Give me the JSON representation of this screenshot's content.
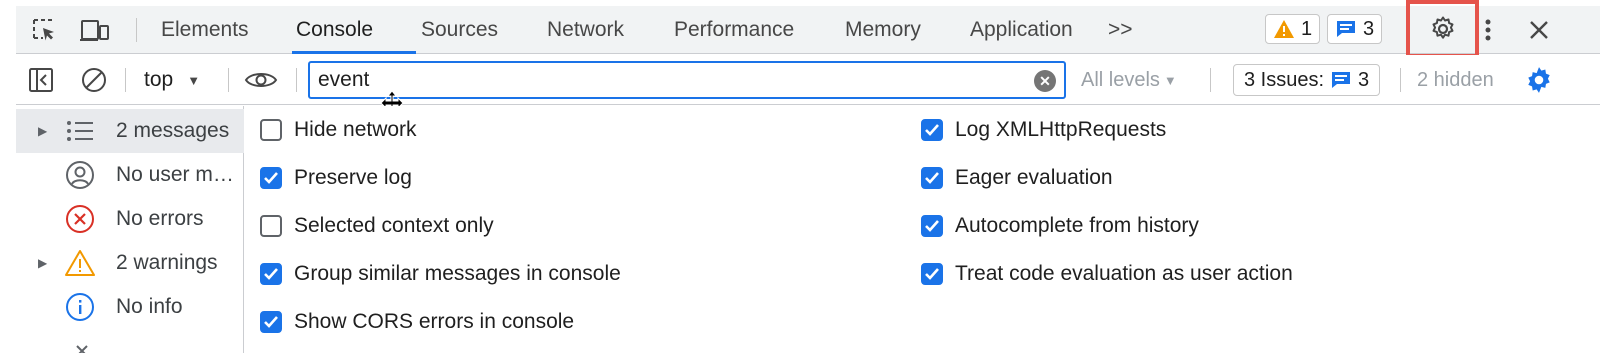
{
  "tabbar": {
    "tabs": [
      {
        "label": "Elements"
      },
      {
        "label": "Console"
      },
      {
        "label": "Sources"
      },
      {
        "label": "Network"
      },
      {
        "label": "Performance"
      },
      {
        "label": "Memory"
      },
      {
        "label": "Application"
      }
    ],
    "active_tab": "Console",
    "more_tabs": ">>",
    "warnings_count": "1",
    "messages_count": "3"
  },
  "toolbar": {
    "context": "top",
    "filter_value": "event",
    "levels": "All levels",
    "issues_label": "3 Issues:",
    "issues_count": "3",
    "hidden": "2 hidden"
  },
  "sidebar": {
    "items": [
      {
        "label": "2 messages",
        "icon": "list-icon",
        "expandable": true
      },
      {
        "label": "No user messages",
        "icon": "user-icon",
        "expandable": false
      },
      {
        "label": "No errors",
        "icon": "error-icon",
        "expandable": false
      },
      {
        "label": "2 warnings",
        "icon": "warning-icon",
        "expandable": true
      },
      {
        "label": "No info",
        "icon": "info-icon",
        "expandable": false
      }
    ]
  },
  "settings": {
    "left": [
      {
        "label": "Hide network",
        "checked": false
      },
      {
        "label": "Preserve log",
        "checked": true
      },
      {
        "label": "Selected context only",
        "checked": false
      },
      {
        "label": "Group similar messages in console",
        "checked": true
      },
      {
        "label": "Show CORS errors in console",
        "checked": true
      }
    ],
    "right": [
      {
        "label": "Log XMLHttpRequests",
        "checked": true
      },
      {
        "label": "Eager evaluation",
        "checked": true
      },
      {
        "label": "Autocomplete from history",
        "checked": true
      },
      {
        "label": "Treat code evaluation as user action",
        "checked": true
      }
    ]
  },
  "colors": {
    "accent": "#1a73e8",
    "warning": "#f29900",
    "error": "#d93025",
    "highlight_frame": "#e5534b"
  }
}
